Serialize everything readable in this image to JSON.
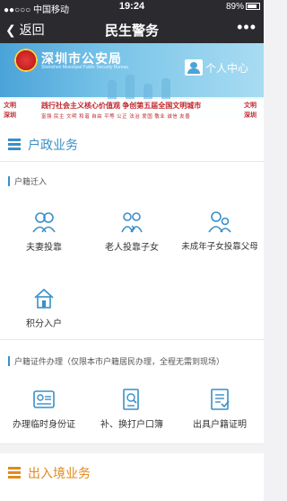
{
  "status": {
    "carrier": "●●○○○ 中国移动",
    "time": "19:24",
    "battery": "89%"
  },
  "nav": {
    "back_label": "返回",
    "title": "民生警务",
    "more": "•••"
  },
  "banner": {
    "dept_name": "深圳市公安局",
    "dept_en": "Shenzhen Municipal Public Security Bureau",
    "user_center": "个人中心",
    "slogan_main": "践行社会主义核心价值观    争创第五届全国文明城市",
    "slogan_values": "富强  民主  文明  和谐  自由  平等  公正  法治  爱国  敬业  诚信  友善",
    "side_left": "文明\n深圳",
    "side_right": "文明\n深圳"
  },
  "sections": {
    "household": {
      "title": "户政业务",
      "sub1": "户籍迁入",
      "items1": [
        "夫妻投靠",
        "老人投靠子女",
        "未成年子女投靠父母",
        "积分入户"
      ],
      "sub2": "户籍证件办理（仅限本市户籍居民办理，全程无需到现场）",
      "items2": [
        "办理临时身份证",
        "补、换打户口簿",
        "出具户籍证明"
      ]
    },
    "exit_entry": {
      "title": "出入境业务"
    }
  },
  "colors": {
    "accent": "#3a8fc7",
    "nav_bg": "#2b2b2f",
    "outer_accent": "#e08a1c"
  }
}
